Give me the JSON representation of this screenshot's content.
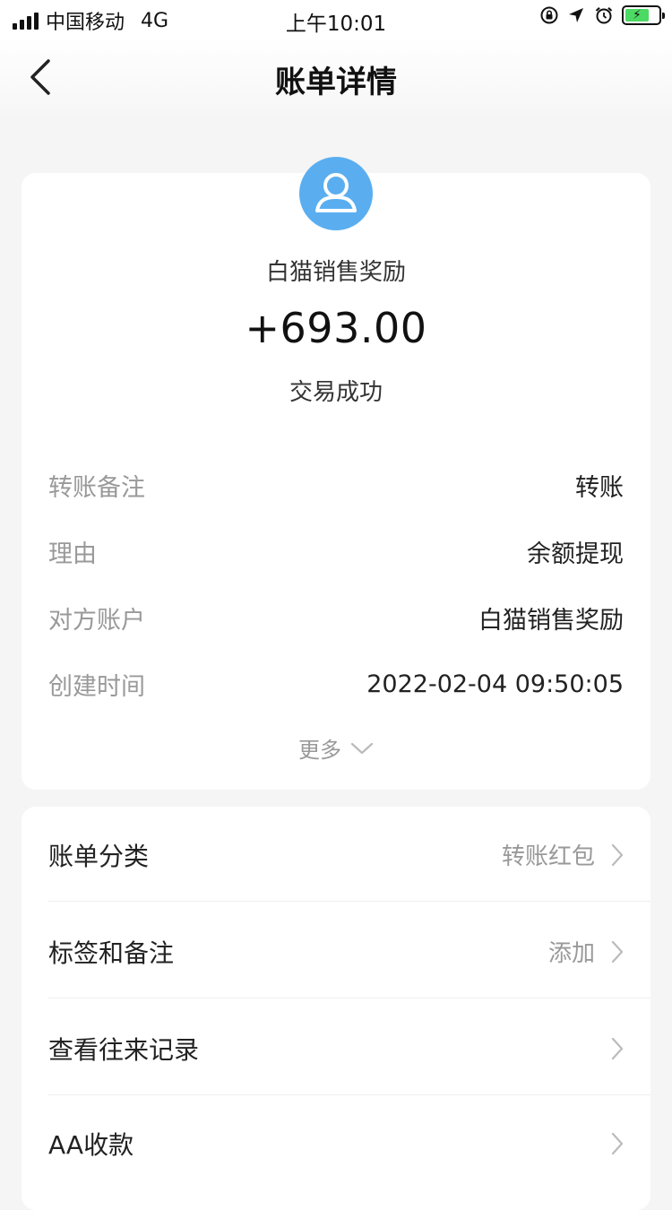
{
  "status_bar": {
    "carrier": "中国移动",
    "network": "4G",
    "time": "上午10:01"
  },
  "nav": {
    "title": "账单详情"
  },
  "summary": {
    "payee_name": "白猫销售奖励",
    "amount": "+693.00",
    "status": "交易成功"
  },
  "details": [
    {
      "label": "转账备注",
      "value": "转账"
    },
    {
      "label": "理由",
      "value": "余额提现"
    },
    {
      "label": "对方账户",
      "value": "白猫销售奖励"
    },
    {
      "label": "创建时间",
      "value": "2022-02-04 09:50:05"
    }
  ],
  "more_label": "更多",
  "menu": [
    {
      "label": "账单分类",
      "value": "转账红包"
    },
    {
      "label": "标签和备注",
      "value": "添加"
    },
    {
      "label": "查看往来记录",
      "value": ""
    },
    {
      "label": "AA收款",
      "value": ""
    }
  ],
  "colors": {
    "avatar_blue": "#5aaef0",
    "battery_green": "#4cd964"
  }
}
